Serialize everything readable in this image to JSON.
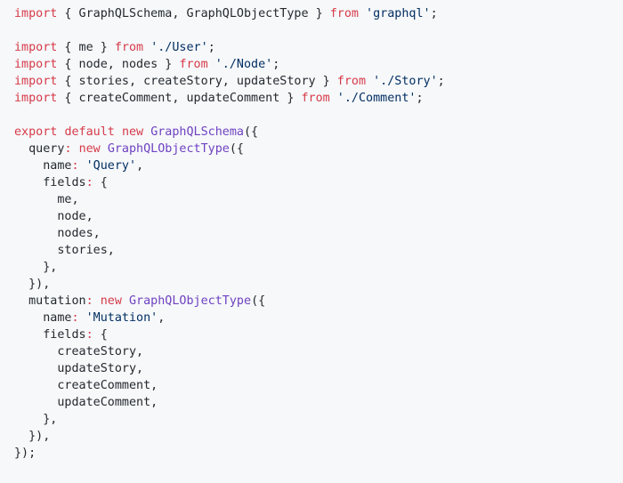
{
  "colors": {
    "background": "#f6f8fa",
    "text": "#24292e",
    "keyword": "#d73a49",
    "string": "#032f62",
    "class": "#6f42c1"
  },
  "code": {
    "lines": [
      [
        {
          "t": "k",
          "v": "import"
        },
        {
          "t": "p",
          "v": " { GraphQLSchema, GraphQLObjectType } "
        },
        {
          "t": "k",
          "v": "from"
        },
        {
          "t": "p",
          "v": " "
        },
        {
          "t": "s",
          "v": "'graphql'"
        },
        {
          "t": "p",
          "v": ";"
        }
      ],
      [],
      [
        {
          "t": "k",
          "v": "import"
        },
        {
          "t": "p",
          "v": " { me } "
        },
        {
          "t": "k",
          "v": "from"
        },
        {
          "t": "p",
          "v": " "
        },
        {
          "t": "s",
          "v": "'./User'"
        },
        {
          "t": "p",
          "v": ";"
        }
      ],
      [
        {
          "t": "k",
          "v": "import"
        },
        {
          "t": "p",
          "v": " { node, nodes } "
        },
        {
          "t": "k",
          "v": "from"
        },
        {
          "t": "p",
          "v": " "
        },
        {
          "t": "s",
          "v": "'./Node'"
        },
        {
          "t": "p",
          "v": ";"
        }
      ],
      [
        {
          "t": "k",
          "v": "import"
        },
        {
          "t": "p",
          "v": " { stories, createStory, updateStory } "
        },
        {
          "t": "k",
          "v": "from"
        },
        {
          "t": "p",
          "v": " "
        },
        {
          "t": "s",
          "v": "'./Story'"
        },
        {
          "t": "p",
          "v": ";"
        }
      ],
      [
        {
          "t": "k",
          "v": "import"
        },
        {
          "t": "p",
          "v": " { createComment, updateComment } "
        },
        {
          "t": "k",
          "v": "from"
        },
        {
          "t": "p",
          "v": " "
        },
        {
          "t": "s",
          "v": "'./Comment'"
        },
        {
          "t": "p",
          "v": ";"
        }
      ],
      [],
      [
        {
          "t": "k",
          "v": "export"
        },
        {
          "t": "p",
          "v": " "
        },
        {
          "t": "k",
          "v": "default"
        },
        {
          "t": "p",
          "v": " "
        },
        {
          "t": "k",
          "v": "new"
        },
        {
          "t": "p",
          "v": " "
        },
        {
          "t": "c",
          "v": "GraphQLSchema"
        },
        {
          "t": "p",
          "v": "({"
        }
      ],
      [
        {
          "t": "p",
          "v": "  query"
        },
        {
          "t": "k",
          "v": ":"
        },
        {
          "t": "p",
          "v": " "
        },
        {
          "t": "k",
          "v": "new"
        },
        {
          "t": "p",
          "v": " "
        },
        {
          "t": "c",
          "v": "GraphQLObjectType"
        },
        {
          "t": "p",
          "v": "({"
        }
      ],
      [
        {
          "t": "p",
          "v": "    name"
        },
        {
          "t": "k",
          "v": ":"
        },
        {
          "t": "p",
          "v": " "
        },
        {
          "t": "s",
          "v": "'Query'"
        },
        {
          "t": "p",
          "v": ","
        }
      ],
      [
        {
          "t": "p",
          "v": "    fields"
        },
        {
          "t": "k",
          "v": ":"
        },
        {
          "t": "p",
          "v": " {"
        }
      ],
      [
        {
          "t": "p",
          "v": "      me,"
        }
      ],
      [
        {
          "t": "p",
          "v": "      node,"
        }
      ],
      [
        {
          "t": "p",
          "v": "      nodes,"
        }
      ],
      [
        {
          "t": "p",
          "v": "      stories,"
        }
      ],
      [
        {
          "t": "p",
          "v": "    },"
        }
      ],
      [
        {
          "t": "p",
          "v": "  }),"
        }
      ],
      [
        {
          "t": "p",
          "v": "  mutation"
        },
        {
          "t": "k",
          "v": ":"
        },
        {
          "t": "p",
          "v": " "
        },
        {
          "t": "k",
          "v": "new"
        },
        {
          "t": "p",
          "v": " "
        },
        {
          "t": "c",
          "v": "GraphQLObjectType"
        },
        {
          "t": "p",
          "v": "({"
        }
      ],
      [
        {
          "t": "p",
          "v": "    name"
        },
        {
          "t": "k",
          "v": ":"
        },
        {
          "t": "p",
          "v": " "
        },
        {
          "t": "s",
          "v": "'Mutation'"
        },
        {
          "t": "p",
          "v": ","
        }
      ],
      [
        {
          "t": "p",
          "v": "    fields"
        },
        {
          "t": "k",
          "v": ":"
        },
        {
          "t": "p",
          "v": " {"
        }
      ],
      [
        {
          "t": "p",
          "v": "      createStory,"
        }
      ],
      [
        {
          "t": "p",
          "v": "      updateStory,"
        }
      ],
      [
        {
          "t": "p",
          "v": "      createComment,"
        }
      ],
      [
        {
          "t": "p",
          "v": "      updateComment,"
        }
      ],
      [
        {
          "t": "p",
          "v": "    },"
        }
      ],
      [
        {
          "t": "p",
          "v": "  }),"
        }
      ],
      [
        {
          "t": "p",
          "v": "});"
        }
      ]
    ]
  }
}
